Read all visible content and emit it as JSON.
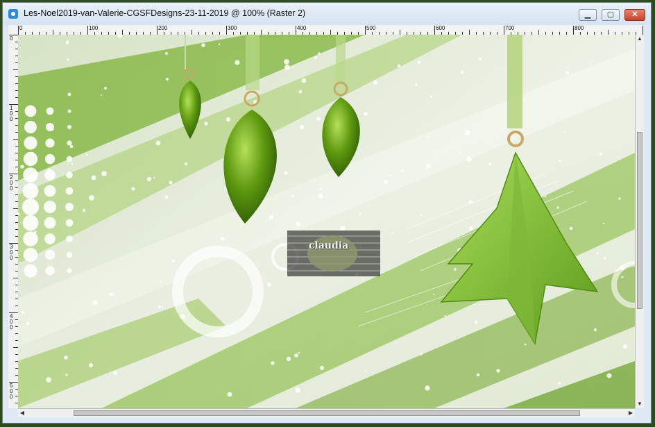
{
  "window": {
    "title": "Les-Noel2019-van-Valerie-CGSFDesigns-23-11-2019 @ 100% (Raster 2)",
    "buttons": {
      "minimize": "▁",
      "maximize": "▢",
      "close": "✕"
    }
  },
  "ruler": {
    "top_labels": [
      "0",
      "100",
      "200",
      "300",
      "400",
      "500",
      "600",
      "700",
      "800"
    ],
    "left_labels": [
      "0",
      "100",
      "200",
      "300",
      "400",
      "500"
    ]
  },
  "canvas": {
    "watermark": "claudia",
    "colors": {
      "green_dark": "#4f8a12",
      "green_mid": "#8cc43c",
      "green_light": "#c9e0a2",
      "bg": "#eef2ea"
    }
  },
  "scrollbars": {
    "up": "▲",
    "down": "▼",
    "left": "◀",
    "right": "▶"
  }
}
